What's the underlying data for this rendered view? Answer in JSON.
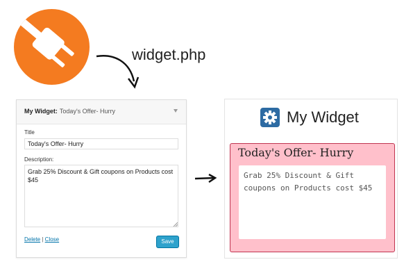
{
  "header": {
    "file_caption": "widget.php",
    "plugin_icon": "plug-icon"
  },
  "editor": {
    "widget_name": "My Widget:",
    "widget_subtitle": "Today's Offer- Hurry",
    "title_label": "Title",
    "title_value": "Today's Offer- Hurry",
    "description_label": "Description:",
    "description_value": "Grab 25% Discount & Gift coupons on Products cost $45",
    "delete_label": "Delete",
    "separator": "|",
    "close_label": "Close",
    "save_label": "Save"
  },
  "output": {
    "widget_title": "My Widget",
    "widget_icon": "gear-icon",
    "offer_title": "Today's Offer- Hurry",
    "offer_body": "Grab 25% Discount & Gift coupons on Products cost $45"
  },
  "colors": {
    "plugin_orange": "#f47b20",
    "offer_background": "#ffc0cb",
    "offer_border": "#c0334f",
    "save_button": "#2ea2cc",
    "link_blue": "#0073aa",
    "widget_icon_blue": "#2d6ba3"
  }
}
